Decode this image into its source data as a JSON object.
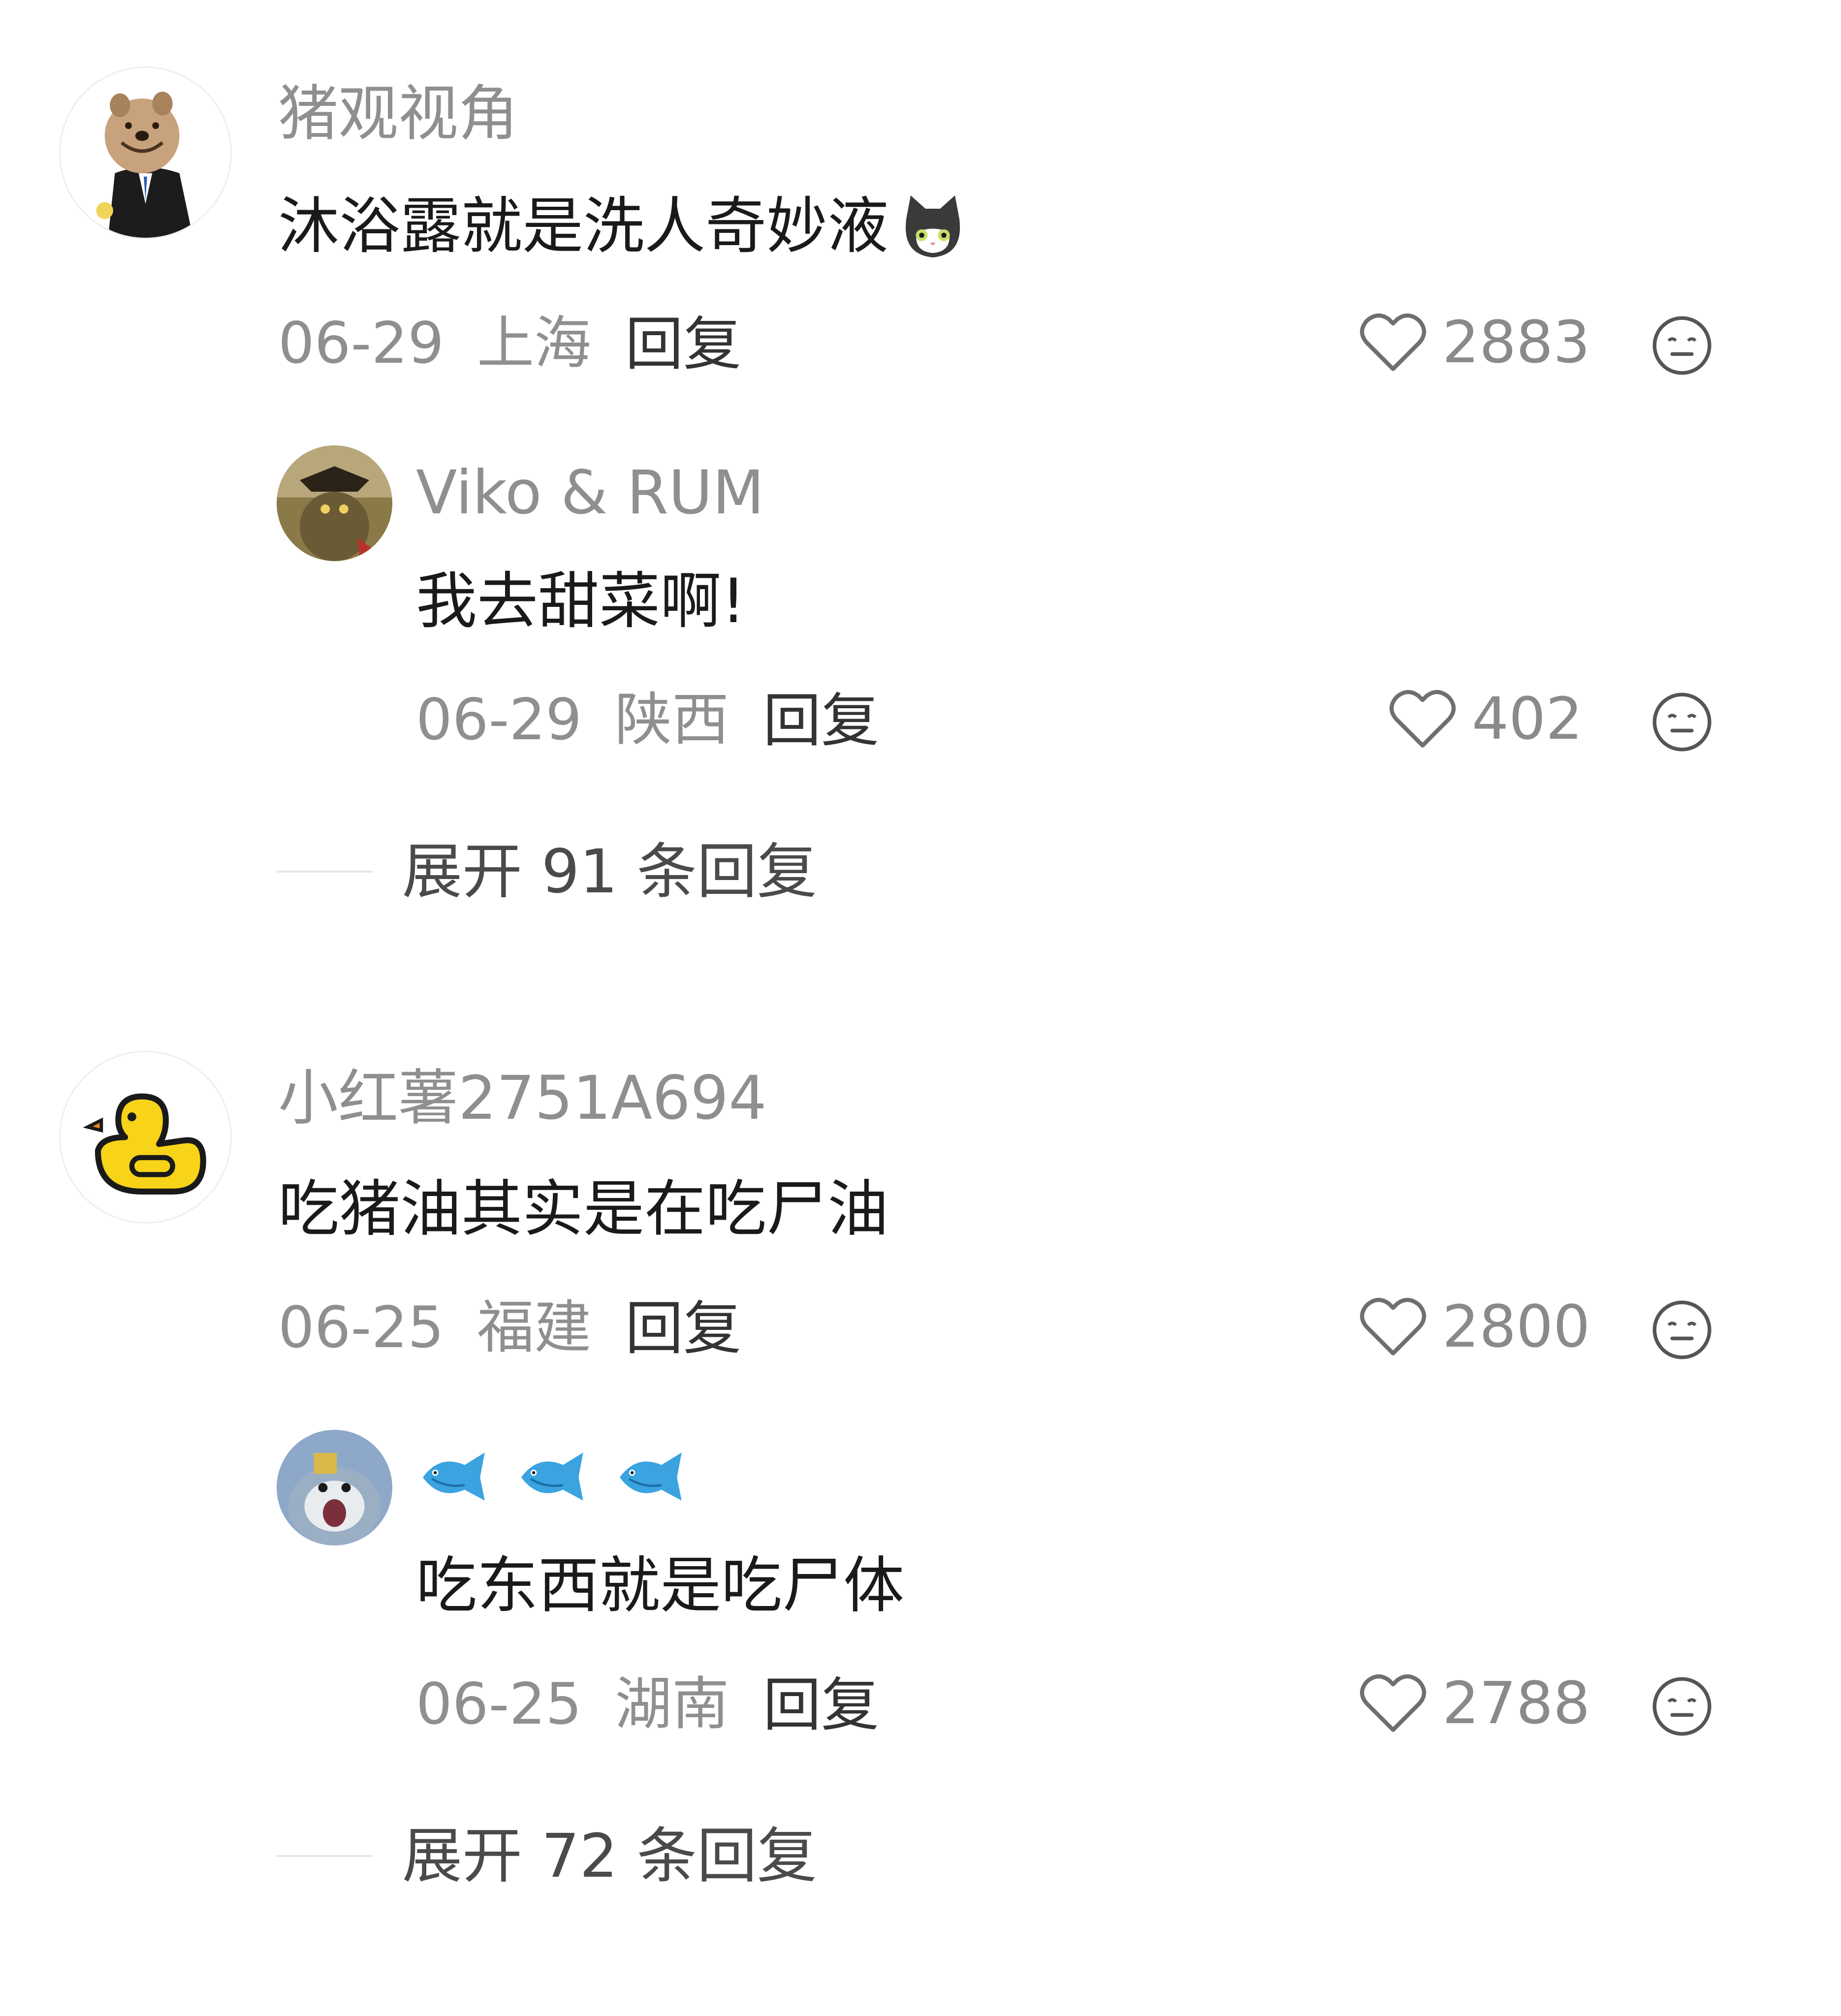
{
  "comments": [
    {
      "username": "猪观视角",
      "text": "沐浴露就是洗人奇妙液",
      "date": "06-29",
      "location": "上海",
      "reply_label": "回复",
      "likes": "2883",
      "replies": [
        {
          "username": "Viko & RUM",
          "text": "我去甜菜啊!",
          "date": "06-29",
          "location": "陕西",
          "reply_label": "回复",
          "likes": "402"
        }
      ],
      "expand_label": "展开 91 条回复"
    },
    {
      "username": "小红薯2751A694",
      "text": "吃猪油其实是在吃尸油",
      "date": "06-25",
      "location": "福建",
      "reply_label": "回复",
      "likes": "2800",
      "replies": [
        {
          "username_icons": [
            "fish-emoji",
            "fish-emoji",
            "fish-emoji"
          ],
          "text": "吃东西就是吃尸体",
          "date": "06-25",
          "location": "湖南",
          "reply_label": "回复",
          "likes": "2788"
        }
      ],
      "expand_label": "展开 72 条回复"
    }
  ],
  "icons": {
    "like": "heart-outline-icon",
    "dislike": "neutral-face-icon",
    "emoji_cat": "cat-emoji",
    "fish": "fish-emoji"
  },
  "colors": {
    "background": "#ffffff",
    "username": "#8f8f8f",
    "text": "#1a1a1a",
    "meta": "#8f8f8f",
    "duck": "#f7d319"
  }
}
